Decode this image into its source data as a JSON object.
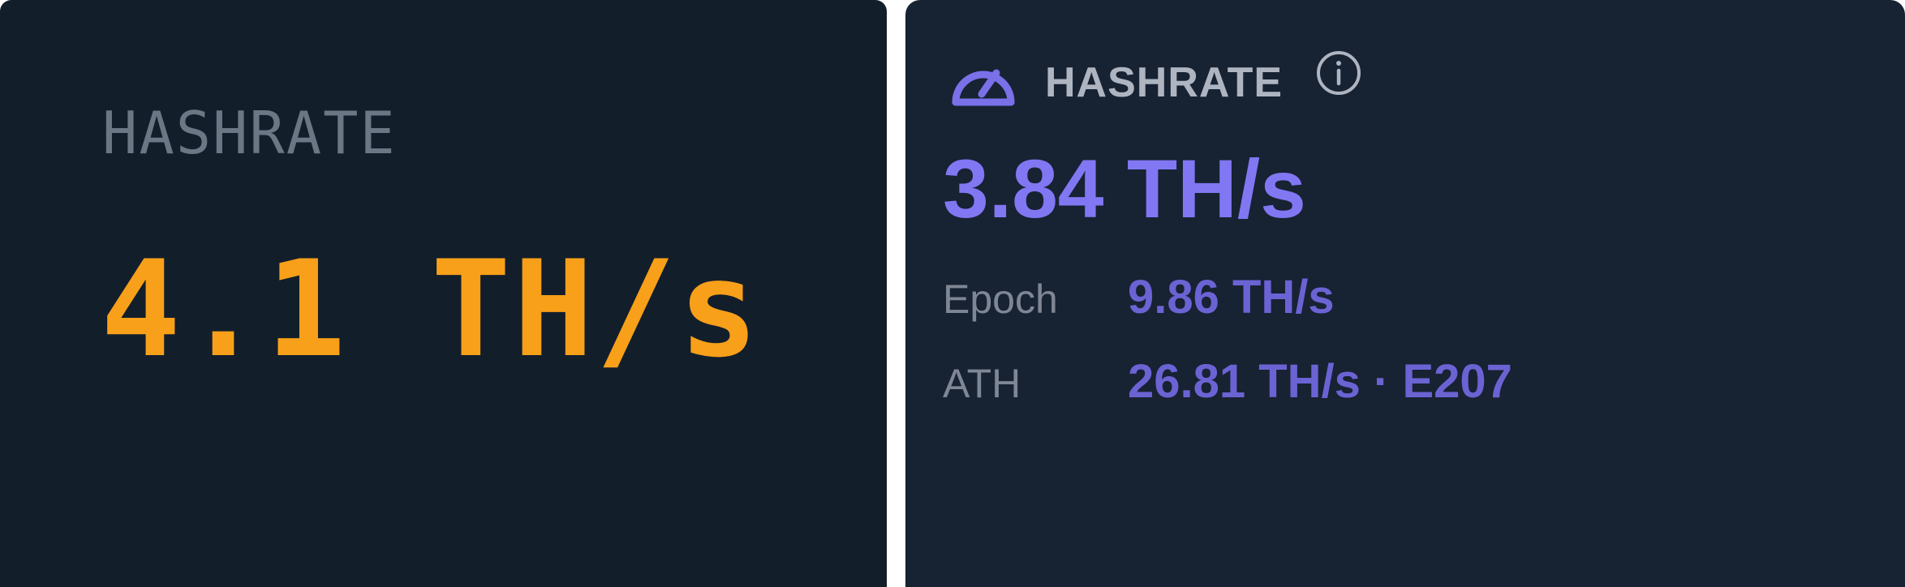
{
  "left_card": {
    "label": "HASHRATE",
    "value": "4.1 TH/s",
    "value_color": "#f8a019"
  },
  "right_card": {
    "icon": "gauge-icon",
    "title": "HASHRATE",
    "info_icon": "info-icon",
    "value": "3.84 TH/s",
    "accent_color": "#8177f3",
    "stats": [
      {
        "label": "Epoch",
        "value": "9.86 TH/s"
      },
      {
        "label": "ATH",
        "value": "26.81 TH/s · E207"
      }
    ]
  }
}
